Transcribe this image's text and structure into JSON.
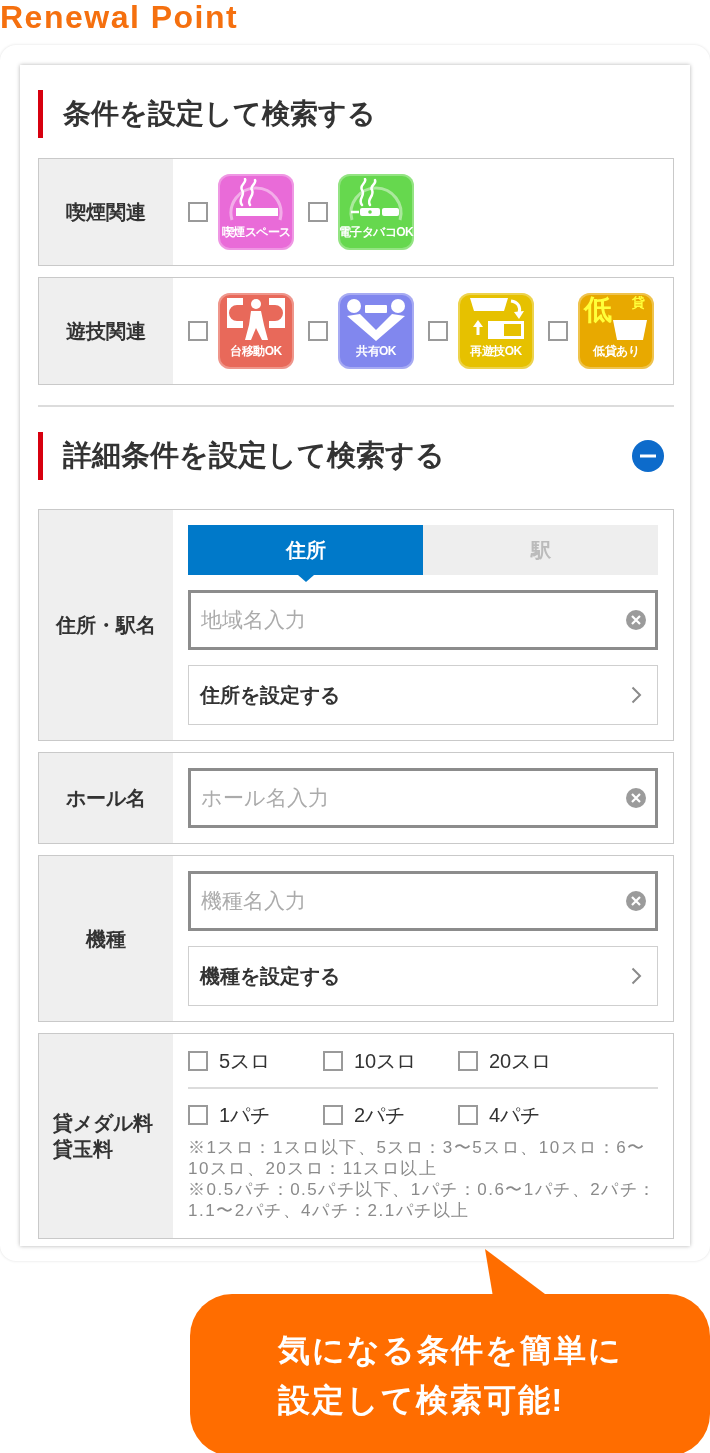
{
  "header": {
    "title": "Renewal Point"
  },
  "basic_search": {
    "heading": "条件を設定して検索する",
    "rows": [
      {
        "label": "喫煙関連",
        "options": [
          {
            "kind": "smoking",
            "caption": "喫煙スペース",
            "color": "#e96bd8",
            "checked": false
          },
          {
            "kind": "e-cigarette",
            "caption": "電子タバコOK",
            "color": "#66d84e",
            "checked": false
          }
        ]
      },
      {
        "label": "遊技関連",
        "options": [
          {
            "kind": "machine-move",
            "caption": "台移動OK",
            "color": "#e8695a",
            "checked": false
          },
          {
            "kind": "share",
            "caption": "共有OK",
            "color": "#8187ee",
            "checked": false
          },
          {
            "kind": "replay",
            "caption": "再遊技OK",
            "color": "#e6c100",
            "checked": false
          },
          {
            "kind": "low-rate",
            "caption": "低貸あり",
            "big_text": "低",
            "small_text": "貸",
            "color": "#e8a900",
            "checked": false
          }
        ]
      }
    ]
  },
  "detail_search": {
    "heading": "詳細条件を設定して検索する",
    "expanded": true,
    "rows": [
      {
        "kind": "fields",
        "label": "住所・駅名",
        "tabs": [
          {
            "label": "住所",
            "selected": true
          },
          {
            "label": "駅",
            "selected": false
          }
        ],
        "input": {
          "placeholder": "地域名入力"
        },
        "link": {
          "label": "住所を設定する"
        }
      },
      {
        "kind": "fields",
        "label": "ホール名",
        "input": {
          "placeholder": "ホール名入力"
        }
      },
      {
        "kind": "fields",
        "label": "機種",
        "input": {
          "placeholder": "機種名入力"
        },
        "link": {
          "label": "機種を設定する"
        }
      },
      {
        "kind": "rates",
        "label": "貸メダル料貸玉料",
        "option_groups": [
          {
            "options": [
              {
                "label": "5スロ",
                "checked": false
              },
              {
                "label": "10スロ",
                "checked": false
              },
              {
                "label": "20スロ",
                "checked": false
              }
            ]
          },
          {
            "options": [
              {
                "label": "1パチ",
                "checked": false
              },
              {
                "label": "2パチ",
                "checked": false
              },
              {
                "label": "4パチ",
                "checked": false
              }
            ]
          }
        ],
        "notes": [
          "※1スロ：1スロ以下、5スロ：3〜5スロ、10スロ：6〜10スロ、20スロ：11スロ以上",
          "※0.5パチ：0.5パチ以下、1パチ：0.6〜1パチ、2パチ：1.1〜2パチ、4パチ：2.1パチ以上"
        ]
      }
    ]
  },
  "callout": {
    "lines": [
      "気になる条件を簡単に",
      "設定して検索可能!"
    ]
  }
}
